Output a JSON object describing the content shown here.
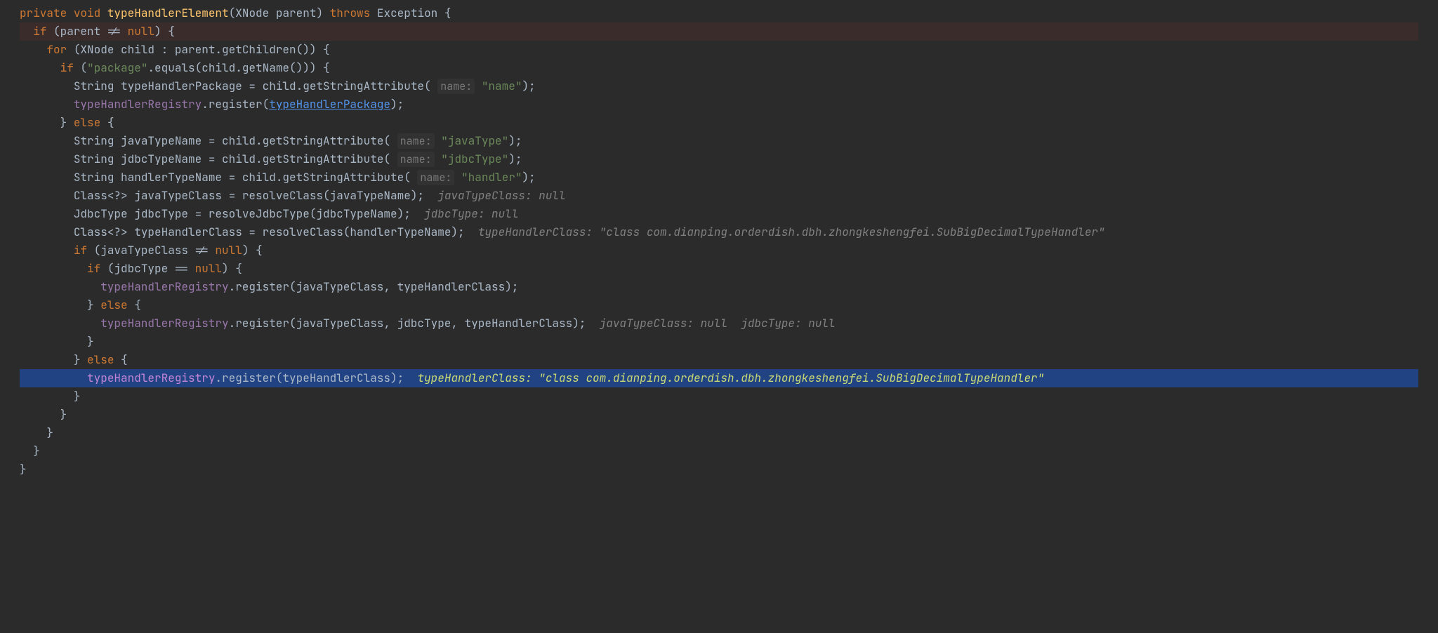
{
  "code": {
    "line1": {
      "private": "private",
      "void": "void",
      "method": "typeHandlerElement",
      "params": "(XNode parent)",
      "throws": "throws",
      "exc": "Exception {"
    },
    "line2": {
      "if": "if",
      "cond": " (parent != ",
      "null": "null",
      "end": ") {"
    },
    "line3": {
      "for": "for",
      "rest": " (XNode child : parent.getChildren()) {"
    },
    "line4": {
      "if": "if",
      "open": " (",
      "str": "\"package\"",
      "rest": ".equals(child.getName())) {"
    },
    "line5": {
      "decl": "String typeHandlerPackage = child.getStringAttribute( ",
      "hint": "name:",
      "str": " \"name\"",
      "end": ");"
    },
    "line6": {
      "field": "typeHandlerRegistry",
      "mid": ".register(",
      "link": "typeHandlerPackage",
      "end": ");"
    },
    "line7": {
      "close": "} ",
      "else": "else",
      "open": " {"
    },
    "line8": {
      "decl": "String javaTypeName = child.getStringAttribute( ",
      "hint": "name:",
      "str": " \"javaType\"",
      "end": ");"
    },
    "line9": {
      "decl": "String jdbcTypeName = child.getStringAttribute( ",
      "hint": "name:",
      "str": " \"jdbcType\"",
      "end": ");"
    },
    "line10": {
      "decl": "String handlerTypeName = child.getStringAttribute( ",
      "hint": "name:",
      "str": " \"handler\"",
      "end": ");"
    },
    "line11": {
      "decl": "Class<?> javaTypeClass = resolveClass(javaTypeName);  ",
      "comment": "javaTypeClass: null"
    },
    "line12": {
      "decl": "JdbcType jdbcType = resolveJdbcType(jdbcTypeName);  ",
      "comment": "jdbcType: null"
    },
    "line13": {
      "decl": "Class<?> typeHandlerClass = resolveClass(handlerTypeName);  ",
      "comment": "typeHandlerClass: \"class com.dianping.orderdish.dbh.zhongkeshengfei.SubBigDecimalTypeHandler\""
    },
    "line14": {
      "if": "if",
      "cond": " (javaTypeClass != ",
      "null": "null",
      "end": ") {"
    },
    "line15": {
      "if": "if",
      "cond": " (jdbcType == ",
      "null": "null",
      "end": ") {"
    },
    "line16": {
      "field": "typeHandlerRegistry",
      "rest": ".register(javaTypeClass, typeHandlerClass);"
    },
    "line17": {
      "close": "} ",
      "else": "else",
      "open": " {"
    },
    "line18": {
      "field": "typeHandlerRegistry",
      "rest": ".register(javaTypeClass, jdbcType, typeHandlerClass);  ",
      "comment": "javaTypeClass: null  jdbcType: null"
    },
    "line19": {
      "brace": "}"
    },
    "line20": {
      "close": "} ",
      "else": "else",
      "open": " {"
    },
    "line21": {
      "field": "typeHandlerRegistry",
      "rest": ".register(typeHandlerClass);  ",
      "comment": "typeHandlerClass: \"class com.dianping.orderdish.dbh.zhongkeshengfei.SubBigDecimalTypeHandler\""
    },
    "line22": {
      "brace": "}"
    },
    "line23": {
      "brace": "}"
    },
    "line24": {
      "brace": "}"
    },
    "line25": {
      "brace": "}"
    },
    "line26": {
      "brace": "}"
    }
  }
}
